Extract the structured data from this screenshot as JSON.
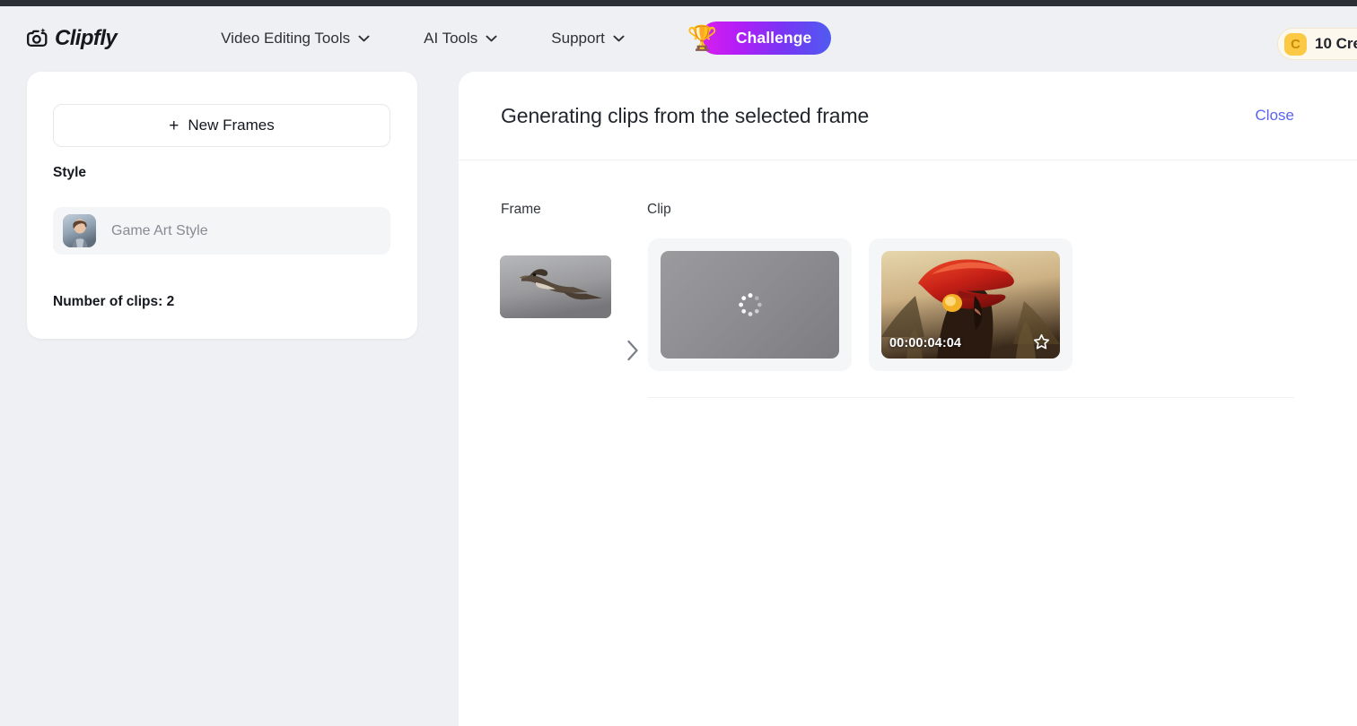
{
  "brand": {
    "name": "Clipfly",
    "logo_icon": "camera-sparkle-icon"
  },
  "header": {
    "nav": [
      {
        "label": "Video Editing Tools",
        "icon": "chevron-down-icon"
      },
      {
        "label": "AI Tools",
        "icon": "chevron-down-icon"
      },
      {
        "label": "Support",
        "icon": "chevron-down-icon"
      }
    ],
    "challenge": {
      "label": "Challenge",
      "icon": "trophy-icon",
      "glyph": "🏆",
      "gradient_from": "#d820ee",
      "gradient_to": "#4f5bf0"
    },
    "credits": {
      "icon": "credit-coin-icon",
      "coin_letter": "C",
      "text": "10 Cre",
      "coin_color": "#fbc944"
    }
  },
  "sidebar": {
    "new_frames_button": {
      "label": "New Frames",
      "icon": "plus-icon",
      "plus": "+"
    },
    "style_section": {
      "heading": "Style",
      "selected": {
        "name": "Game Art Style",
        "avatar": "style-avatar-thumbnail"
      }
    },
    "clip_count_label": "Number of clips: 2"
  },
  "main": {
    "title": "Generating clips from the selected frame",
    "close_label": "Close",
    "columns": {
      "frame": "Frame",
      "clip": "Clip"
    },
    "arrow_icon": "chevron-right-icon",
    "frame": {
      "name": "source-frame-thumbnail",
      "description": "bird in flight"
    },
    "clips": [
      {
        "state": "loading",
        "icon": "loading-spinner-icon",
        "timecode": "",
        "favorite_icon": ""
      },
      {
        "state": "ready",
        "icon": "",
        "timecode": "00:00:04:04",
        "favorite_icon": "star-outline-icon"
      }
    ]
  },
  "colors": {
    "page_bg": "#eef0f3",
    "panel_bg": "#ffffff",
    "accent_link": "#5a63ef",
    "text_primary": "#15181e",
    "text_muted": "#868b94"
  }
}
